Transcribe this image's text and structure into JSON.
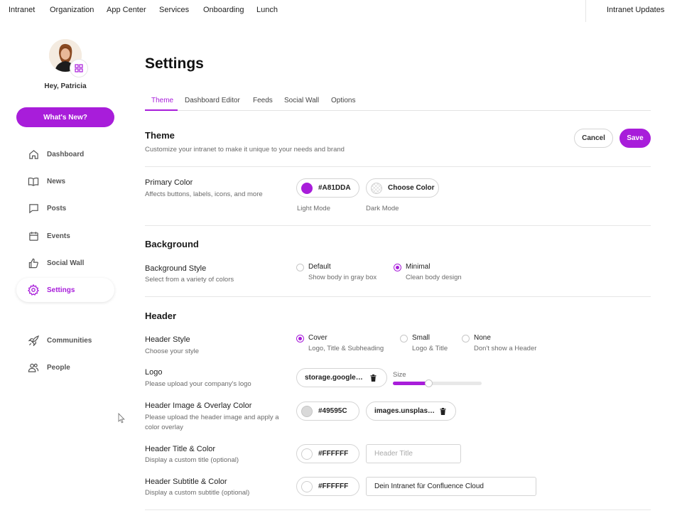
{
  "topnav": {
    "items": [
      "Intranet",
      "Organization",
      "App Center",
      "Services",
      "Onboarding",
      "Lunch"
    ],
    "right": "Intranet Updates"
  },
  "sidebar": {
    "greeting": "Hey, Patricia",
    "whats_new": "What's New?",
    "items": [
      {
        "label": "Dashboard",
        "icon": "home-icon"
      },
      {
        "label": "News",
        "icon": "book-icon"
      },
      {
        "label": "Posts",
        "icon": "chat-bubble-icon"
      },
      {
        "label": "Events",
        "icon": "calendar-icon"
      },
      {
        "label": "Social Wall",
        "icon": "thumbs-up-icon"
      },
      {
        "label": "Settings",
        "icon": "gear-icon",
        "active": true
      },
      {
        "label": "Communities",
        "icon": "rocket-icon"
      },
      {
        "label": "People",
        "icon": "people-icon"
      }
    ]
  },
  "main": {
    "title": "Settings",
    "tabs": [
      "Theme",
      "Dashboard Editor",
      "Feeds",
      "Social Wall",
      "Options"
    ],
    "active_tab": "Theme",
    "theme": {
      "title": "Theme",
      "desc": "Customize your intranet to make it unique to your needs and brand",
      "cancel": "Cancel",
      "save": "Save"
    },
    "primary_color": {
      "title": "Primary Color",
      "desc": "Affects buttons, labels, icons, and more",
      "light_value": "#A81DDA",
      "light_label": "Light Mode",
      "dark_value": "Choose Color",
      "dark_label": "Dark Mode"
    },
    "background": {
      "section": "Background",
      "title": "Background Style",
      "desc": "Select from a variety of colors",
      "options": [
        {
          "label": "Default",
          "desc": "Show body in gray box",
          "checked": false
        },
        {
          "label": "Minimal",
          "desc": "Clean body design",
          "checked": true
        }
      ]
    },
    "header": {
      "section": "Header",
      "style_title": "Header Style",
      "style_desc": "Choose your style",
      "style_options": [
        {
          "label": "Cover",
          "desc": "Logo, Title & Subheading",
          "checked": true
        },
        {
          "label": "Small",
          "desc": "Logo & Title",
          "checked": false
        },
        {
          "label": "None",
          "desc": "Don't show a Header",
          "checked": false
        }
      ],
      "logo_title": "Logo",
      "logo_desc": "Please upload your company's logo",
      "logo_file": "storage.googleapis.com",
      "size_label": "Size",
      "size_fraction": 0.4,
      "image_title": "Header Image & Overlay Color",
      "image_desc": "Please upload the header image and apply a color overlay",
      "overlay_color": "#49595C",
      "image_file": "images.unsplash.com",
      "title_title": "Header Title & Color",
      "title_desc": "Display a custom title (optional)",
      "title_color": "#FFFFFF",
      "title_placeholder": "Header Title",
      "title_value": "",
      "subtitle_title": "Header Subtitle & Color",
      "subtitle_desc": "Display a custom subtitle (optional)",
      "subtitle_color": "#FFFFFF",
      "subtitle_value": "Dein Intranet für Confluence Cloud"
    }
  },
  "colors": {
    "accent": "#A81DDA",
    "overlay_swatch": "#D9D9D9",
    "white_swatch": "#FFFFFF"
  }
}
